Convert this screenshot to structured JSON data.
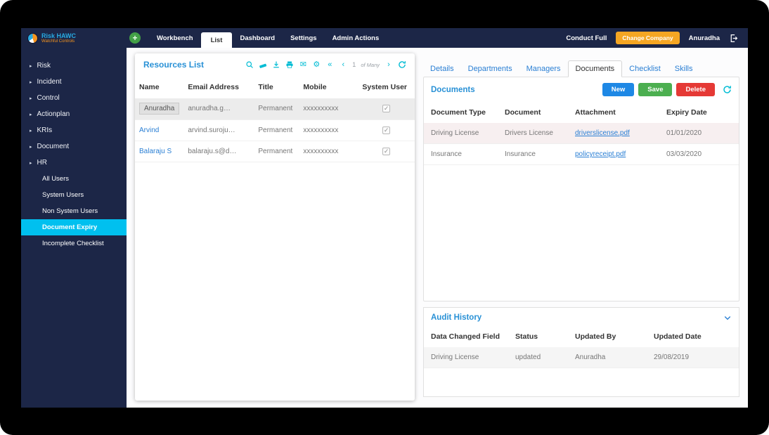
{
  "accents": {
    "navy": "#1c2647",
    "cyan_tools": "#00bcd4",
    "active_sidebar": "#00c0ef",
    "primary_blue": "#2991d6",
    "link_blue": "#2a7fd4",
    "orange": "#f5a623",
    "green": "#4caf50",
    "red": "#e53935"
  },
  "icons": {
    "plus": "+",
    "triangle": "▸",
    "envelope": "✉",
    "gear": "⚙",
    "rewind": "«",
    "prev": "‹",
    "next": "›"
  },
  "topbar": {
    "logo_title": "Risk HAWC",
    "logo_subtitle": "Watchful Controls",
    "nav": [
      {
        "label": "Workbench"
      },
      {
        "label": "List",
        "active": true
      },
      {
        "label": "Dashboard"
      },
      {
        "label": "Settings"
      },
      {
        "label": "Admin Actions"
      }
    ],
    "conduct_full_label": "Conduct Full",
    "change_company_label": "Change Company",
    "username": "Anuradha"
  },
  "sidebar": {
    "items": [
      {
        "label": "Risk"
      },
      {
        "label": "Incident"
      },
      {
        "label": "Control"
      },
      {
        "label": "Actionplan"
      },
      {
        "label": "KRIs"
      },
      {
        "label": "Document"
      },
      {
        "label": "HR",
        "expanded": true
      }
    ],
    "hr_children": [
      {
        "label": "All Users"
      },
      {
        "label": "System Users"
      },
      {
        "label": "Non System Users"
      },
      {
        "label": "Document Expiry",
        "active": true
      },
      {
        "label": "Incomplete Checklist"
      }
    ]
  },
  "resources": {
    "title": "Resources List",
    "pagination": {
      "page": "1",
      "of_label": "of Many"
    },
    "columns": {
      "name": "Name",
      "email": "Email Address",
      "title": "Title",
      "mobile": "Mobile",
      "system_user": "System User"
    },
    "rows": [
      {
        "name": "Anuradha",
        "email": "anuradha.g…",
        "title": "Permanent",
        "mobile": "xxxxxxxxxx",
        "system_user": true,
        "selected": true
      },
      {
        "name": "Arvind",
        "email": "arvind.suroju…",
        "title": "Permanent",
        "mobile": "xxxxxxxxxx",
        "system_user": true
      },
      {
        "name": "Balaraju S",
        "email": "balaraju.s@d…",
        "title": "Permanent",
        "mobile": "xxxxxxxxxx",
        "system_user": true
      }
    ]
  },
  "details": {
    "tabs": [
      {
        "label": "Details"
      },
      {
        "label": "Departments"
      },
      {
        "label": "Managers"
      },
      {
        "label": "Documents",
        "active": true
      },
      {
        "label": "Checklist"
      },
      {
        "label": "Skills"
      }
    ],
    "documents": {
      "title": "Documents",
      "new_label": "New",
      "save_label": "Save",
      "delete_label": "Delete",
      "columns": {
        "type": "Document Type",
        "document": "Document",
        "attachment": "Attachment",
        "expiry": "Expiry Date"
      },
      "rows": [
        {
          "type": "Driving License",
          "document": "Drivers License",
          "attachment": "driverslicense.pdf",
          "expiry": "01/01/2020",
          "expired": true
        },
        {
          "type": "Insurance",
          "document": "Insurance",
          "attachment": "policyreceipt.pdf",
          "expiry": "03/03/2020",
          "expired": false
        }
      ]
    },
    "audit": {
      "title": "Audit History",
      "columns": {
        "field": "Data Changed Field",
        "status": "Status",
        "updated_by": "Updated By",
        "updated_date": "Updated Date"
      },
      "rows": [
        {
          "field": "Driving License",
          "status": "updated",
          "updated_by": "Anuradha",
          "updated_date": "29/08/2019"
        }
      ]
    }
  }
}
